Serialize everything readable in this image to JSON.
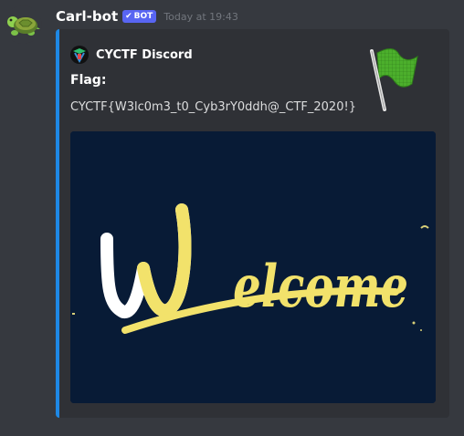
{
  "message": {
    "username": "Carl-bot",
    "bot_badge": "BOT",
    "bot_check_icon": "checkmark-icon",
    "timestamp": "Today at 19:43",
    "avatar_icon": "turtle-icon"
  },
  "embed": {
    "accent_color": "#1e88e5",
    "author_name": "CYCTF Discord",
    "author_icon": "cyctf-logo-icon",
    "field_name": "Flag:",
    "field_value": "CYCTF{W3lc0m3_t0_Cyb3rY0ddh@_CTF_2020!}",
    "thumbnail_icon": "green-flag-icon",
    "image_text": "Welcome"
  },
  "colors": {
    "background": "#36393f",
    "embed_background": "#2f3136",
    "image_background": "#081b36",
    "welcome_yellow": "#f2e26b"
  }
}
